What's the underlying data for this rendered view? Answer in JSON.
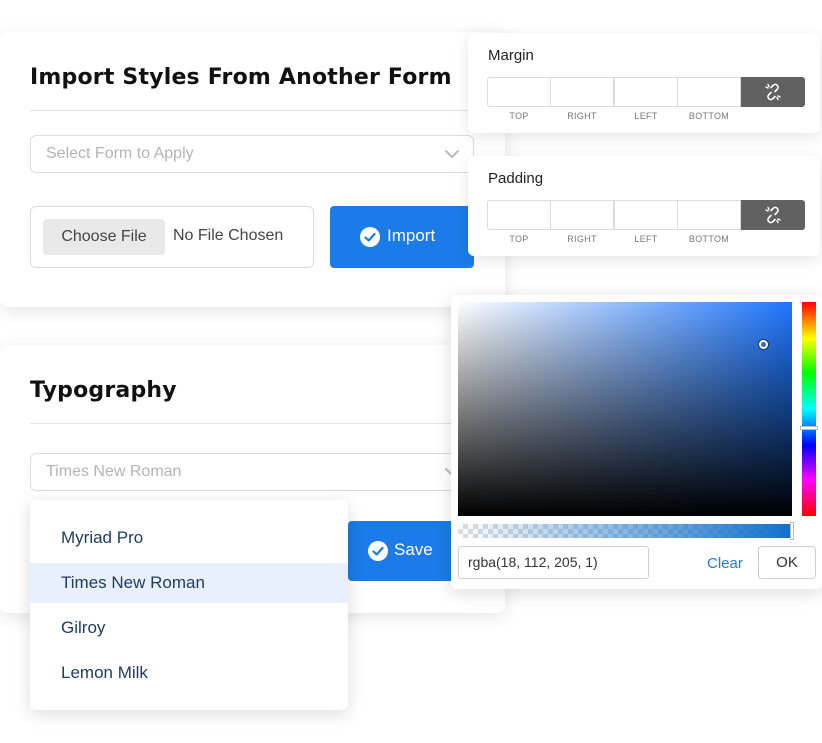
{
  "import_section": {
    "title": "Import Styles From Another Form",
    "select_placeholder": "Select Form to Apply",
    "choose_file_label": "Choose File",
    "file_status": "No File Chosen",
    "import_label": "Import"
  },
  "typography_section": {
    "title": "Typography",
    "selected_font": "Times New Roman",
    "save_label": "Save",
    "font_options": [
      {
        "label": "Myriad Pro",
        "selected": false
      },
      {
        "label": "Times New Roman",
        "selected": true
      },
      {
        "label": "Gilroy",
        "selected": false
      },
      {
        "label": "Lemon Milk",
        "selected": false
      }
    ]
  },
  "margin": {
    "title": "Margin",
    "labels": [
      "TOP",
      "RIGHT",
      "LEFT",
      "BOTTOM"
    ],
    "link_icon": "unlink-icon"
  },
  "padding": {
    "title": "Padding",
    "labels": [
      "TOP",
      "RIGHT",
      "LEFT",
      "BOTTOM"
    ],
    "link_icon": "unlink-icon"
  },
  "color_picker": {
    "value": "rgba(18, 112, 205, 1)",
    "clear_label": "Clear",
    "ok_label": "OK"
  },
  "colors": {
    "accent": "#1b7be8",
    "menu_text": "#1f3b66",
    "menu_selected_bg": "#e8f0fd",
    "link_button_bg": "#616161"
  }
}
